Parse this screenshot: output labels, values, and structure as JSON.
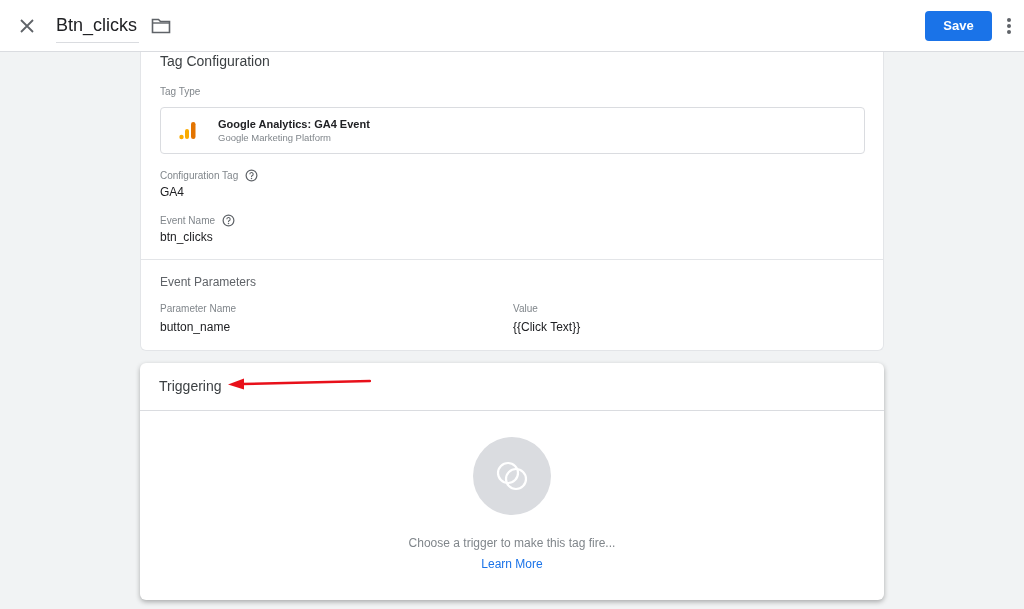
{
  "header": {
    "title": "Btn_clicks",
    "save_label": "Save"
  },
  "tag_configuration": {
    "title": "Tag Configuration",
    "tag_type_label": "Tag Type",
    "tag_type": {
      "name": "Google Analytics: GA4 Event",
      "provider": "Google Marketing Platform"
    },
    "fields": [
      {
        "label": "Configuration Tag",
        "value": "GA4",
        "help": true
      },
      {
        "label": "Event Name",
        "value": "btn_clicks",
        "help": true
      }
    ],
    "event_parameters": {
      "title": "Event Parameters",
      "columns": [
        "Parameter Name",
        "Value"
      ],
      "rows": [
        [
          "button_name",
          "{{Click Text}}"
        ]
      ]
    }
  },
  "triggering": {
    "title": "Triggering",
    "message": "Choose a trigger to make this tag fire...",
    "link": "Learn More"
  }
}
